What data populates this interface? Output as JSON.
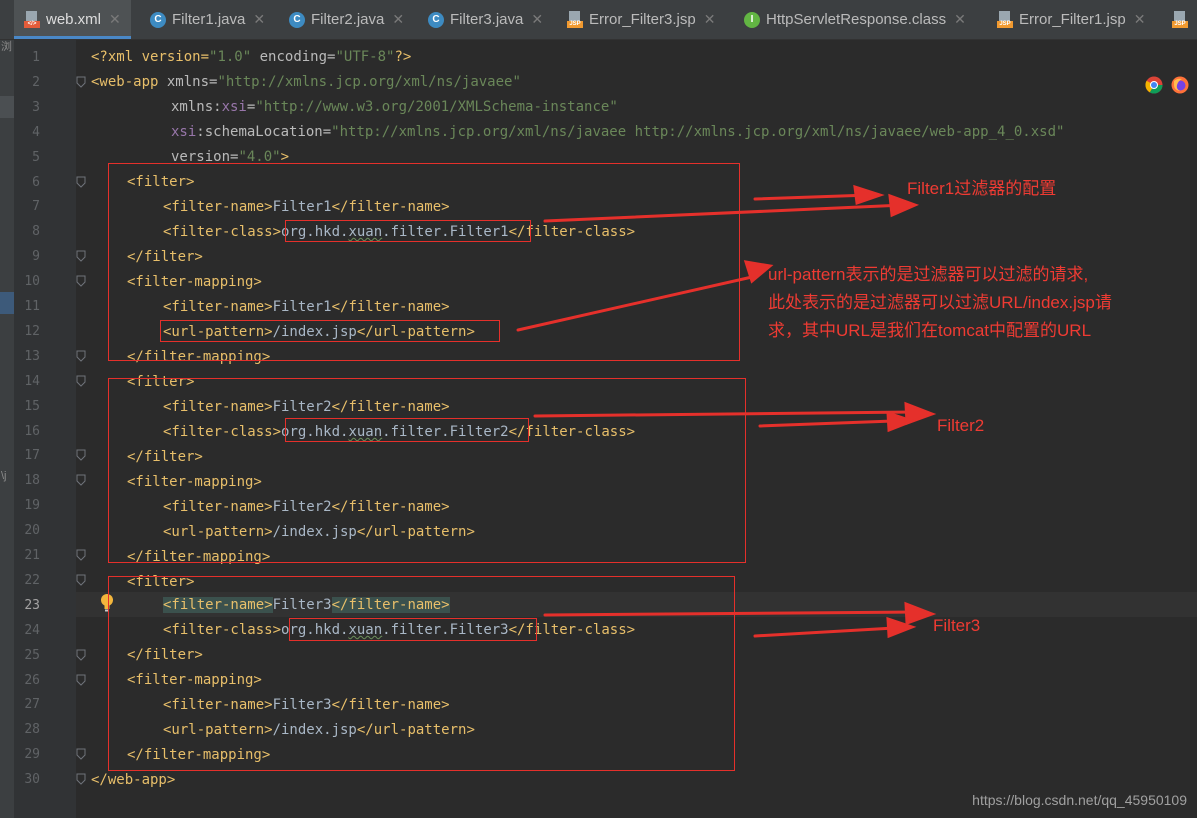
{
  "tabs": [
    {
      "label": "web.xml",
      "icon": "xml-file-icon",
      "active": true
    },
    {
      "label": "Filter1.java",
      "icon": "java-class-icon"
    },
    {
      "label": "Filter2.java",
      "icon": "java-class-icon"
    },
    {
      "label": "Filter3.java",
      "icon": "java-class-icon"
    },
    {
      "label": "Error_Filter3.jsp",
      "icon": "jsp-file-icon"
    },
    {
      "label": "HttpServletResponse.class",
      "icon": "interface-class-icon"
    },
    {
      "label": "Error_Filter1.jsp",
      "icon": "jsp-file-icon"
    }
  ],
  "left_strip": {
    "top_text": "浏",
    "mid_text": "\\j"
  },
  "line_numbers": [
    "1",
    "2",
    "3",
    "4",
    "5",
    "6",
    "7",
    "8",
    "9",
    "10",
    "11",
    "12",
    "13",
    "14",
    "15",
    "16",
    "17",
    "18",
    "19",
    "20",
    "21",
    "22",
    "23",
    "24",
    "25",
    "26",
    "27",
    "28",
    "29",
    "30"
  ],
  "current_line": "23",
  "code": {
    "l1": {
      "a": "<?xml version=",
      "b": "\"1.0\"",
      "c": " encoding=",
      "d": "\"UTF-8\"",
      "e": "?>"
    },
    "l2": {
      "a": "<web-app",
      "b": " xmlns=",
      "c": "\"http://xmlns.jcp.org/xml/ns/javaee\""
    },
    "l3": {
      "a": "xmlns:",
      "b": "xsi",
      "c": "=",
      "d": "\"http://www.w3.org/2001/XMLSchema-instance\""
    },
    "l4": {
      "a": "xsi",
      "b": ":schemaLocation=",
      "c": "\"http://xmlns.jcp.org/xml/ns/javaee http://xmlns.jcp.org/xml/ns/javaee/web-app_4_0.xsd\""
    },
    "l5": {
      "a": "version=",
      "b": "\"4.0\"",
      "c": ">"
    },
    "open_filter": "<filter>",
    "close_filter": "</filter>",
    "open_mapping": "<filter-mapping>",
    "close_mapping": "</filter-mapping>",
    "open_name": "<filter-name>",
    "close_name": "</filter-name>",
    "open_class": "<filter-class>",
    "close_class": "</filter-class>",
    "open_url": "<url-pattern>",
    "close_url": "</url-pattern>",
    "name1": "Filter1",
    "name2": "Filter2",
    "name3": "Filter3",
    "class_pkg_a": "org.hkd.",
    "class_pkg_b": "xuan",
    "class_pkg_c": ".filter.",
    "class1": "Filter1",
    "class2": "Filter2",
    "class3": "Filter3",
    "url": "/index.jsp",
    "close_webapp": "</web-app>"
  },
  "annotations": {
    "filter1": "Filter1过滤器的配置",
    "url_pattern_l1": "url-pattern表示的是过滤器可以过滤的请求,",
    "url_pattern_l2": "此处表示的是过滤器可以过滤URL/index.jsp请",
    "url_pattern_l3": "求，其中URL是我们在tomcat中配置的URL",
    "filter2": "Filter2",
    "filter3": "Filter3"
  },
  "watermark": "https://blog.csdn.net/qq_45950109",
  "colors": {
    "annotation_red": "#e5302b",
    "tag": "#e8bf6a",
    "string": "#6a8759",
    "background": "#2b2b2b"
  }
}
